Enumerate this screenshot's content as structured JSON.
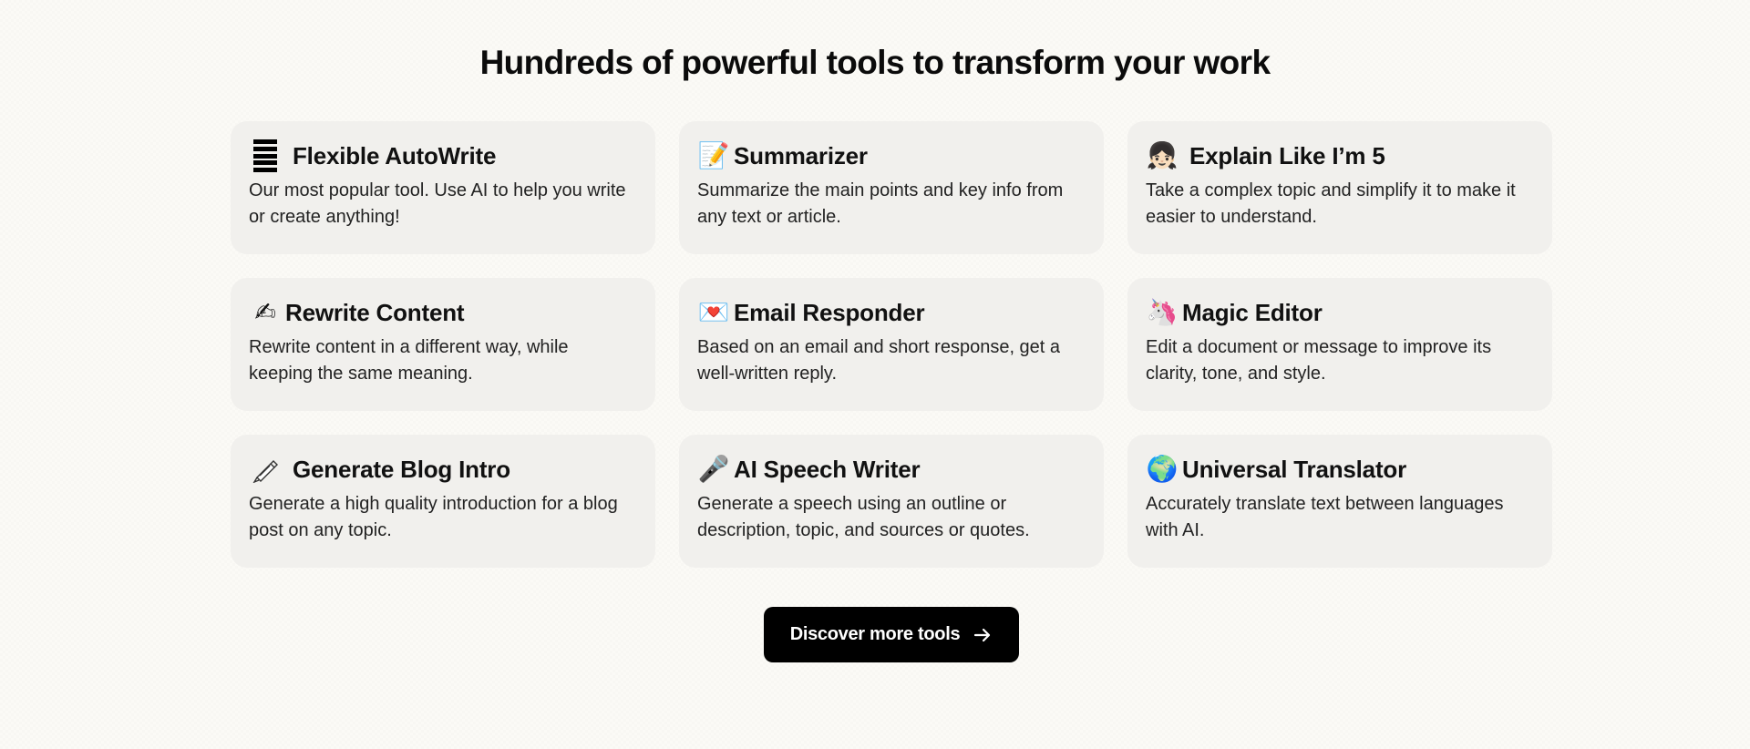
{
  "section": {
    "heading": "Hundreds of powerful tools to transform your work"
  },
  "tools": [
    {
      "icon": "bars-icon",
      "glyph": "",
      "title": "Flexible AutoWrite",
      "description": "Our most popular tool. Use AI to help you write or create anything!"
    },
    {
      "icon": "memo-icon",
      "glyph": "📝",
      "title": "Summarizer",
      "description": "Summarize the main points and key info from any text or article."
    },
    {
      "icon": "girl-icon",
      "glyph": "👧🏻",
      "title": "Explain Like I’m 5",
      "description": "Take a complex topic and simplify it to make it easier to understand."
    },
    {
      "icon": "writing-hand-icon",
      "glyph": "✍",
      "title": "Rewrite Content",
      "description": "Rewrite content in a different way, while keeping the same meaning."
    },
    {
      "icon": "love-letter-icon",
      "glyph": "💌",
      "title": "Email Responder",
      "description": "Based on an email and short response, get a well-written reply."
    },
    {
      "icon": "unicorn-icon",
      "glyph": "🦄",
      "title": "Magic Editor",
      "description": "Edit a document or message to improve its clarity, tone, and style."
    },
    {
      "icon": "pen-icon",
      "glyph": "🖊",
      "title": "Generate Blog Intro",
      "description": "Generate a high quality introduction for a blog post on any topic."
    },
    {
      "icon": "microphone-icon",
      "glyph": "🎤",
      "title": "AI Speech Writer",
      "description": "Generate a speech using an outline or description, topic, and sources or quotes."
    },
    {
      "icon": "globe-icon",
      "glyph": "🌍",
      "title": "Universal Translator",
      "description": "Accurately translate text between languages with AI."
    }
  ],
  "cta": {
    "label": "Discover more tools",
    "icon": "arrow-right-icon"
  },
  "colors": {
    "background": "#fbfaf6",
    "card": "#f1f0ed",
    "button": "#000000",
    "button_text": "#ffffff"
  }
}
